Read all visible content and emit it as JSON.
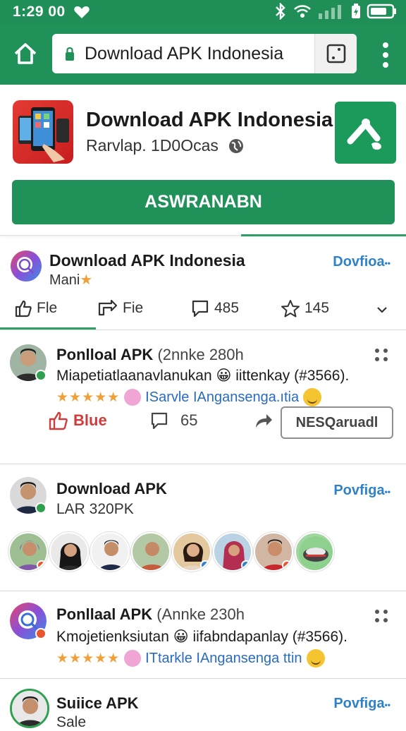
{
  "status_bar": {
    "time": "1:29",
    "extra": "00"
  },
  "toolbar": {
    "url": "Download APK Indonesia"
  },
  "app": {
    "title": "Download APK Indonesia",
    "subtitle": "Rarvlap. 1D0Ocas",
    "install_label": "ASWRANABN"
  },
  "page": {
    "name": "Download APK Indonesia",
    "sub": "Mani",
    "follow": "Dovfioa",
    "stats": [
      {
        "icon": "thumb-up-icon",
        "label": "Fle"
      },
      {
        "icon": "share-arrow-icon",
        "label": "Fie"
      },
      {
        "icon": "chat-icon",
        "label": "485"
      },
      {
        "icon": "star-icon",
        "label": "145"
      }
    ]
  },
  "posts": [
    {
      "name": "Ponlloal APK",
      "meta": "(2nnke 280h",
      "text": "Miapetiatlaanavlanukan 😀 iittenkay (#3566).",
      "stars": "★★★★★",
      "rating_label": "ISarvle IAngansenga.ıtia",
      "actions": {
        "like": "Blue",
        "comments": "65",
        "download": "NESQaruadl"
      }
    },
    {
      "name": "Download APK",
      "sub": "LAR 320PK",
      "follow": "Povfiga"
    },
    {
      "name": "Ponllaal APK",
      "meta": "(Annke 230h",
      "text": "Kmojetienksiutan 😀 iifabndapanlay (#3566).",
      "stars": "★★★★★",
      "rating_label": "ITtarkle IAngansenga ttin"
    },
    {
      "name": "Suiice APK",
      "sub": "Sale",
      "follow": "Povfiga"
    }
  ],
  "colors": {
    "brand_green": "#21915a",
    "link_blue": "#2f82c8",
    "like_red": "#d23b3b",
    "star_orange": "#f0a03a"
  }
}
